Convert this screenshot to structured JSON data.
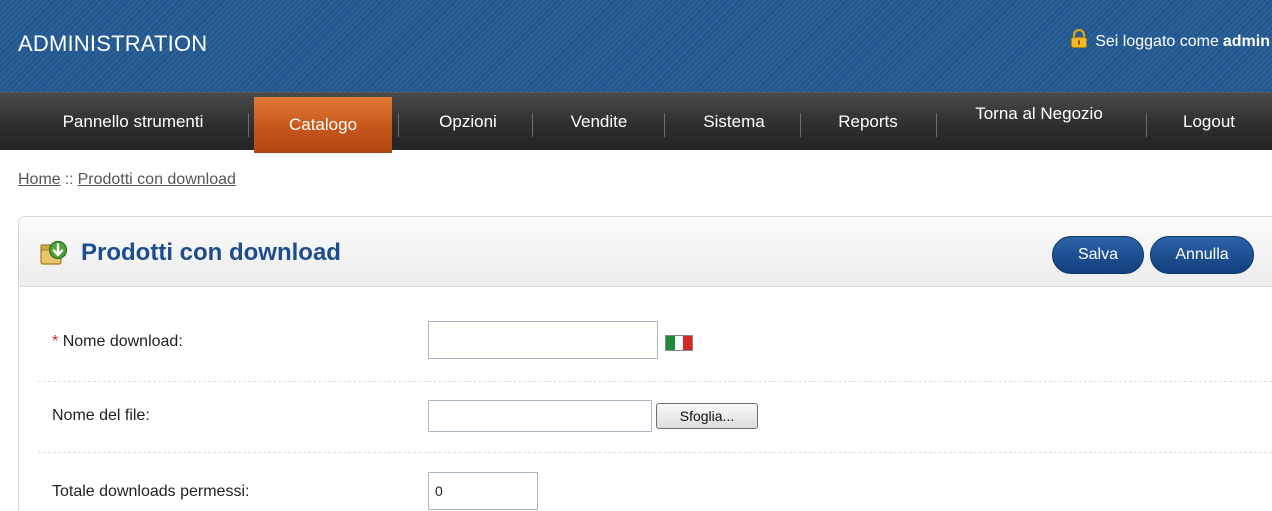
{
  "header": {
    "title": "ADMINISTRATION",
    "login_prefix": "Sei loggato come",
    "login_user": "admin"
  },
  "nav": {
    "items": [
      {
        "label": "Pannello strumenti"
      },
      {
        "label": "Catalogo",
        "active": true
      },
      {
        "label": "Opzioni"
      },
      {
        "label": "Vendite"
      },
      {
        "label": "Sistema"
      },
      {
        "label": "Reports"
      },
      {
        "label": "Torna al Negozio"
      },
      {
        "label": "Logout"
      }
    ]
  },
  "breadcrumb": {
    "home": "Home",
    "separator": "::",
    "current": "Prodotti con download"
  },
  "panel": {
    "title": "Prodotti con download",
    "save_label": "Salva",
    "cancel_label": "Annulla"
  },
  "form": {
    "required_mark": "*",
    "download_name_label": "Nome download:",
    "download_name_value": "",
    "file_name_label": "Nome del file:",
    "file_name_value": "",
    "browse_label": "Sfoglia...",
    "total_downloads_label": "Totale downloads permessi:",
    "total_downloads_value": "0"
  },
  "colors": {
    "header_bg": "#235a93",
    "nav_active": "#c4541a",
    "title_blue": "#1e4d8c",
    "required_red": "#d12a2a"
  },
  "icons": {
    "lock": "lock-icon",
    "panel": "download-box-icon",
    "flag": "italian-flag-icon"
  }
}
